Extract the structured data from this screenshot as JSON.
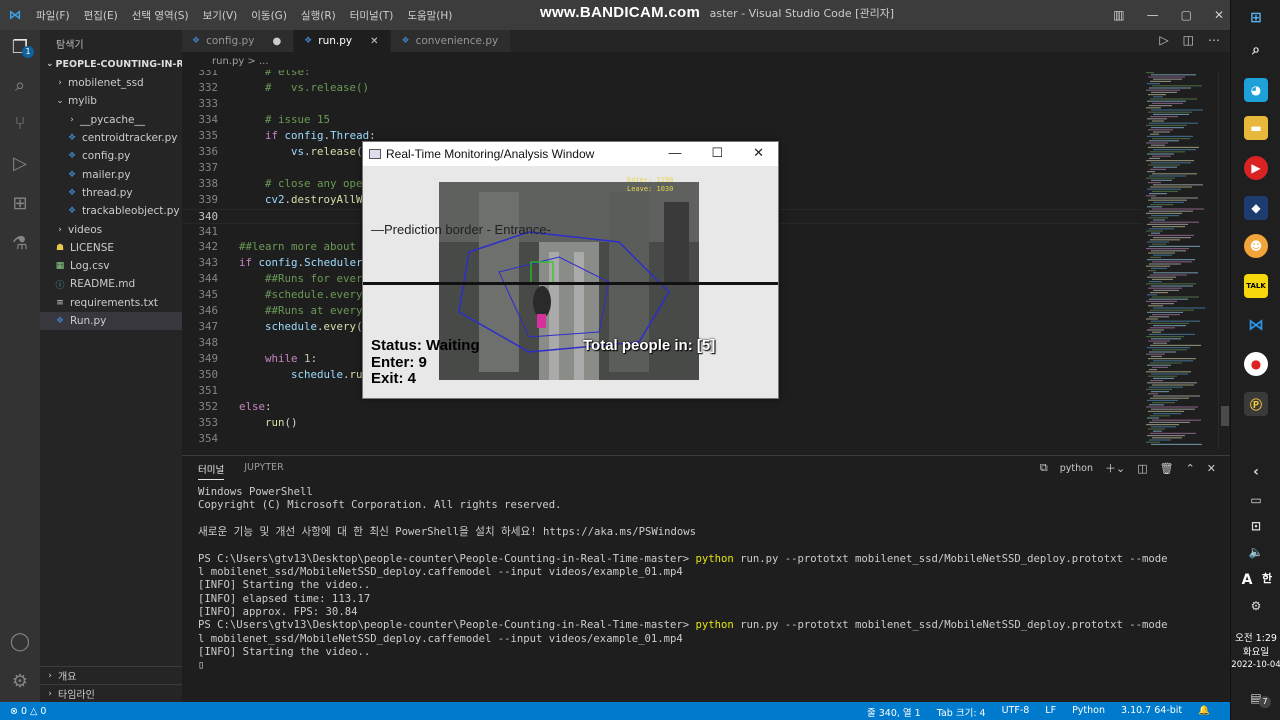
{
  "titlebar": {
    "menu": [
      "파일(F)",
      "편집(E)",
      "선택 영역(S)",
      "보기(V)",
      "이동(G)",
      "실행(R)",
      "터미널(T)",
      "도움말(H)"
    ],
    "watermark": "www.BANDICAM.com",
    "title": "aster - Visual Studio Code [관리자]"
  },
  "sidebar": {
    "title": "탐색기",
    "project": "PEOPLE-COUNTING-IN-RE...",
    "items": [
      {
        "label": "mobilenet_ssd",
        "type": "folder",
        "depth": 1,
        "open": false
      },
      {
        "label": "mylib",
        "type": "folder",
        "depth": 1,
        "open": true
      },
      {
        "label": "__pycache__",
        "type": "folder",
        "depth": 2,
        "open": false
      },
      {
        "label": "centroidtracker.py",
        "type": "py",
        "depth": 2
      },
      {
        "label": "config.py",
        "type": "py",
        "depth": 2
      },
      {
        "label": "mailer.py",
        "type": "py",
        "depth": 2
      },
      {
        "label": "thread.py",
        "type": "py",
        "depth": 2
      },
      {
        "label": "trackableobject.py",
        "type": "py",
        "depth": 2
      },
      {
        "label": "videos",
        "type": "folder",
        "depth": 1,
        "open": false
      },
      {
        "label": "LICENSE",
        "type": "license",
        "depth": 1
      },
      {
        "label": "Log.csv",
        "type": "csv",
        "depth": 1
      },
      {
        "label": "README.md",
        "type": "md",
        "depth": 1
      },
      {
        "label": "requirements.txt",
        "type": "txt",
        "depth": 1
      },
      {
        "label": "Run.py",
        "type": "py",
        "depth": 1,
        "selected": true
      }
    ],
    "outline": "개요",
    "timeline": "타임라인"
  },
  "tabs": [
    {
      "label": "config.py",
      "modified": true
    },
    {
      "label": "run.py",
      "active": true
    },
    {
      "label": "convenience.py"
    }
  ],
  "breadcrumb": "run.py > ...",
  "editor": {
    "current_line": "340",
    "lines": [
      {
        "n": "331",
        "html": "<span class='c'>    # else:</span>"
      },
      {
        "n": "332",
        "html": "<span class='c'>    #   vs.release()</span>"
      },
      {
        "n": "333",
        "html": ""
      },
      {
        "n": "334",
        "html": "<span class='c'>    # issue 15</span>"
      },
      {
        "n": "335",
        "html": "    <span class='k'>if</span> <span class='v'>config</span>.<span class='v'>Thread</span>:"
      },
      {
        "n": "336",
        "html": "        <span class='v'>vs</span>.<span class='f'>release</span>("
      },
      {
        "n": "337",
        "html": ""
      },
      {
        "n": "338",
        "html": "<span class='c'>    # close any ope</span>"
      },
      {
        "n": "339",
        "html": "    <span class='v'>cv2</span>.<span class='f'>destroyAllW</span>"
      },
      {
        "n": "340",
        "html": ""
      },
      {
        "n": "341",
        "html": ""
      },
      {
        "n": "342",
        "html": "<span class='c'>##learn more about</span>"
      },
      {
        "n": "343",
        "html": "<span class='k'>if</span> <span class='v'>config</span>.<span class='v'>Scheduler</span>"
      },
      {
        "n": "344",
        "html": "<span class='c'>    ##Runs for ever</span>"
      },
      {
        "n": "345",
        "html": "<span class='c'>    #schedule.every</span>"
      },
      {
        "n": "346",
        "html": "<span class='c'>    ##Runs at every</span>"
      },
      {
        "n": "347",
        "html": "    <span class='v'>schedule</span>.<span class='f'>every</span>("
      },
      {
        "n": "348",
        "html": ""
      },
      {
        "n": "349",
        "html": "    <span class='k'>while</span> <span class='n'>1</span>:"
      },
      {
        "n": "350",
        "html": "        <span class='v'>schedule</span>.<span class='f'>ru</span>"
      },
      {
        "n": "351",
        "html": ""
      },
      {
        "n": "352",
        "html": "<span class='k'>else</span>:"
      },
      {
        "n": "353",
        "html": "    <span class='f'>run</span>()"
      },
      {
        "n": "354",
        "html": ""
      }
    ]
  },
  "popup": {
    "title": "Real-Time Monitoring/Analysis Window",
    "prediction_border": "—Prediction border - Entrance-",
    "status": "Status: Waiting",
    "enter": "Enter: 9",
    "exit": "Exit: 4",
    "total": "Total people in:  [5]",
    "cam_enter": "Enter: 1190",
    "cam_leave": "Leave: 1030"
  },
  "panel": {
    "tabs": [
      "터미널",
      "JUPYTER"
    ],
    "shell_label": "python",
    "terminal": [
      "Windows PowerShell",
      "Copyright (C) Microsoft Corporation. All rights reserved.",
      "",
      "새로운 기능 및 개선 사항에 대 한 최신 PowerShell을 설치 하세요! https://aka.ms/PSWindows",
      "",
      "PS C:\\Users\\gtv13\\Desktop\\people-counter\\People-Counting-in-Real-Time-master> |python| run.py --prototxt mobilenet_ssd/MobileNetSSD_deploy.prototxt --mode",
      "l mobilenet_ssd/MobileNetSSD_deploy.caffemodel --input videos/example_01.mp4",
      "[INFO] Starting the video..",
      "[INFO] elapsed time: 113.17",
      "[INFO] approx. FPS: 30.84",
      "PS C:\\Users\\gtv13\\Desktop\\people-counter\\People-Counting-in-Real-Time-master> |python| run.py --prototxt mobilenet_ssd/MobileNetSSD_deploy.prototxt --mode",
      "l mobilenet_ssd/MobileNetSSD_deploy.caffemodel --input videos/example_01.mp4",
      "[INFO] Starting the video..",
      "▯"
    ]
  },
  "statusbar": {
    "errors": "⊗ 0 △ 0",
    "position": "줄 340, 열 1",
    "tab_size": "Tab 크기: 4",
    "encoding": "UTF-8",
    "eol": "LF",
    "language": "Python",
    "interpreter": "3.10.7 64-bit"
  },
  "taskbar": {
    "time": "오전 1:29",
    "day": "화요일",
    "date": "2022-10-04",
    "ime": "A",
    "ime2": "한",
    "notif_count": "7",
    "talk": "TALK"
  },
  "colors": {
    "accent": "#007acc",
    "titlebar": "#3c3c3c",
    "sidebar": "#252526",
    "editor": "#1e1e1e"
  }
}
